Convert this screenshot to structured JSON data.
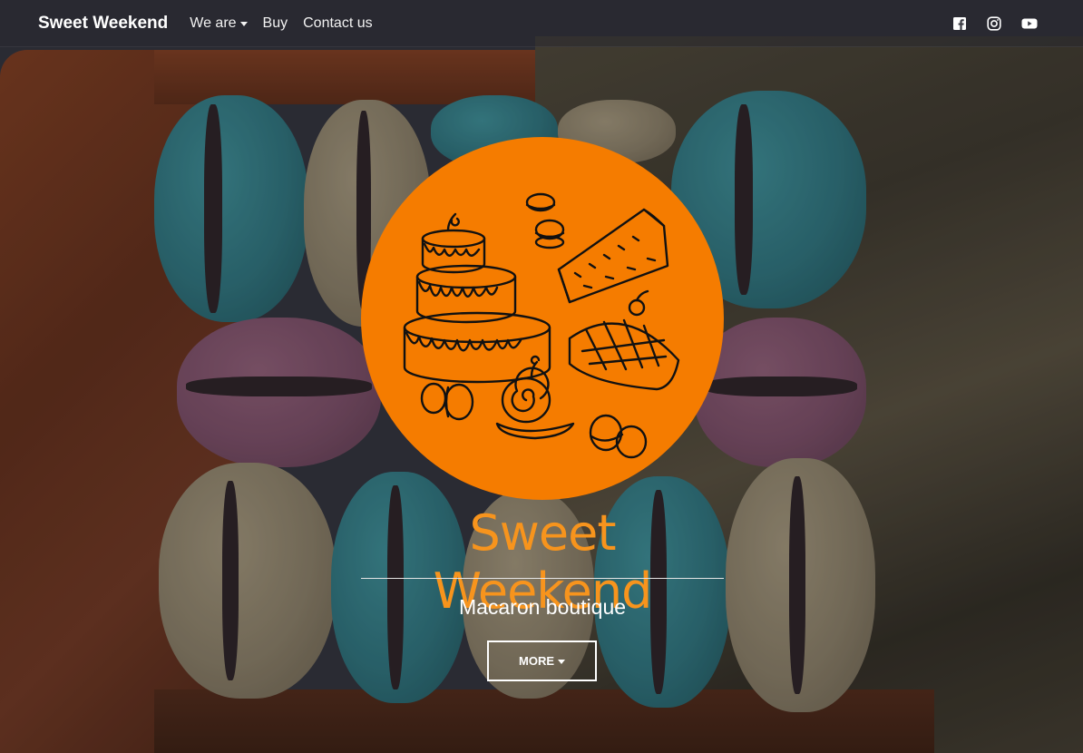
{
  "navbar": {
    "brand": "Sweet Weekend",
    "links": [
      {
        "label": "We are",
        "has_dropdown": true
      },
      {
        "label": "Buy",
        "has_dropdown": false
      },
      {
        "label": "Contact us",
        "has_dropdown": false
      }
    ],
    "social_icons": [
      "facebook-icon",
      "instagram-icon",
      "youtube-icon"
    ]
  },
  "hero": {
    "logo_icon": "desserts-illustration-icon",
    "title": "Sweet Weekend",
    "subtitle": "Macaron boutique",
    "button_label": "MORE"
  },
  "colors": {
    "brand_orange": "#f57c00",
    "title_orange": "#f7941d",
    "text_white": "#ffffff"
  }
}
